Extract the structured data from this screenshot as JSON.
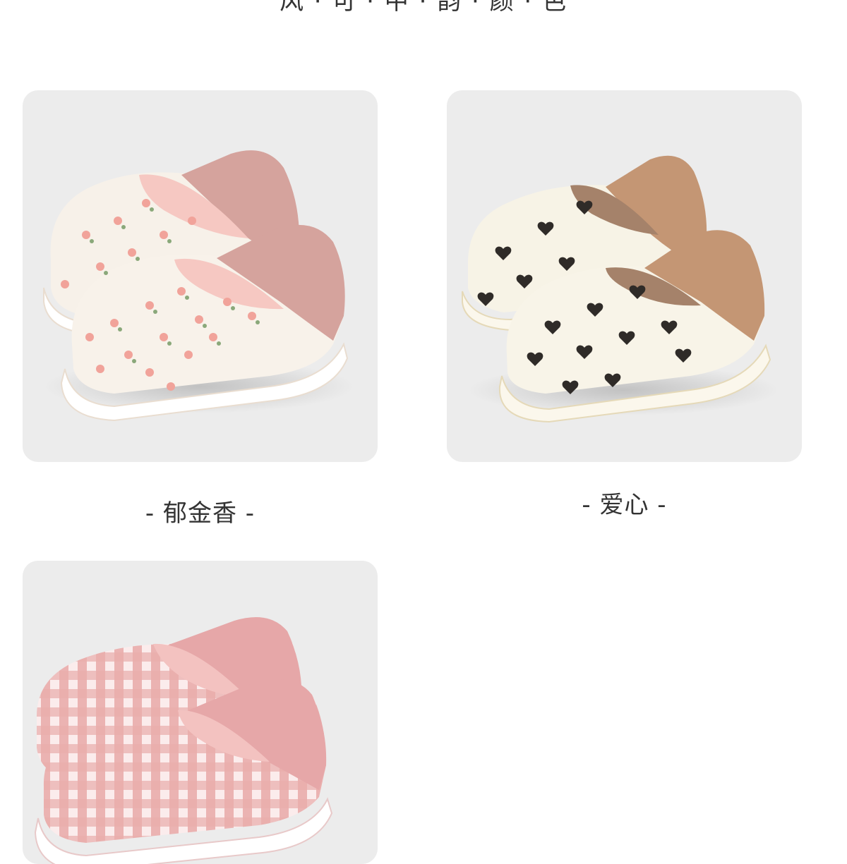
{
  "header": {
    "partial_title": "风 · 可 · 中 · 韵 · 颜 · 色"
  },
  "products": [
    {
      "label": "- 郁金香 -",
      "pattern": "tulip-print",
      "accent": "#d9a6a0"
    },
    {
      "label": "- 爱心 -",
      "pattern": "heart-print",
      "accent": "#c49674"
    },
    {
      "label": "",
      "pattern": "pink-check",
      "accent": "#e6a7a8"
    }
  ]
}
